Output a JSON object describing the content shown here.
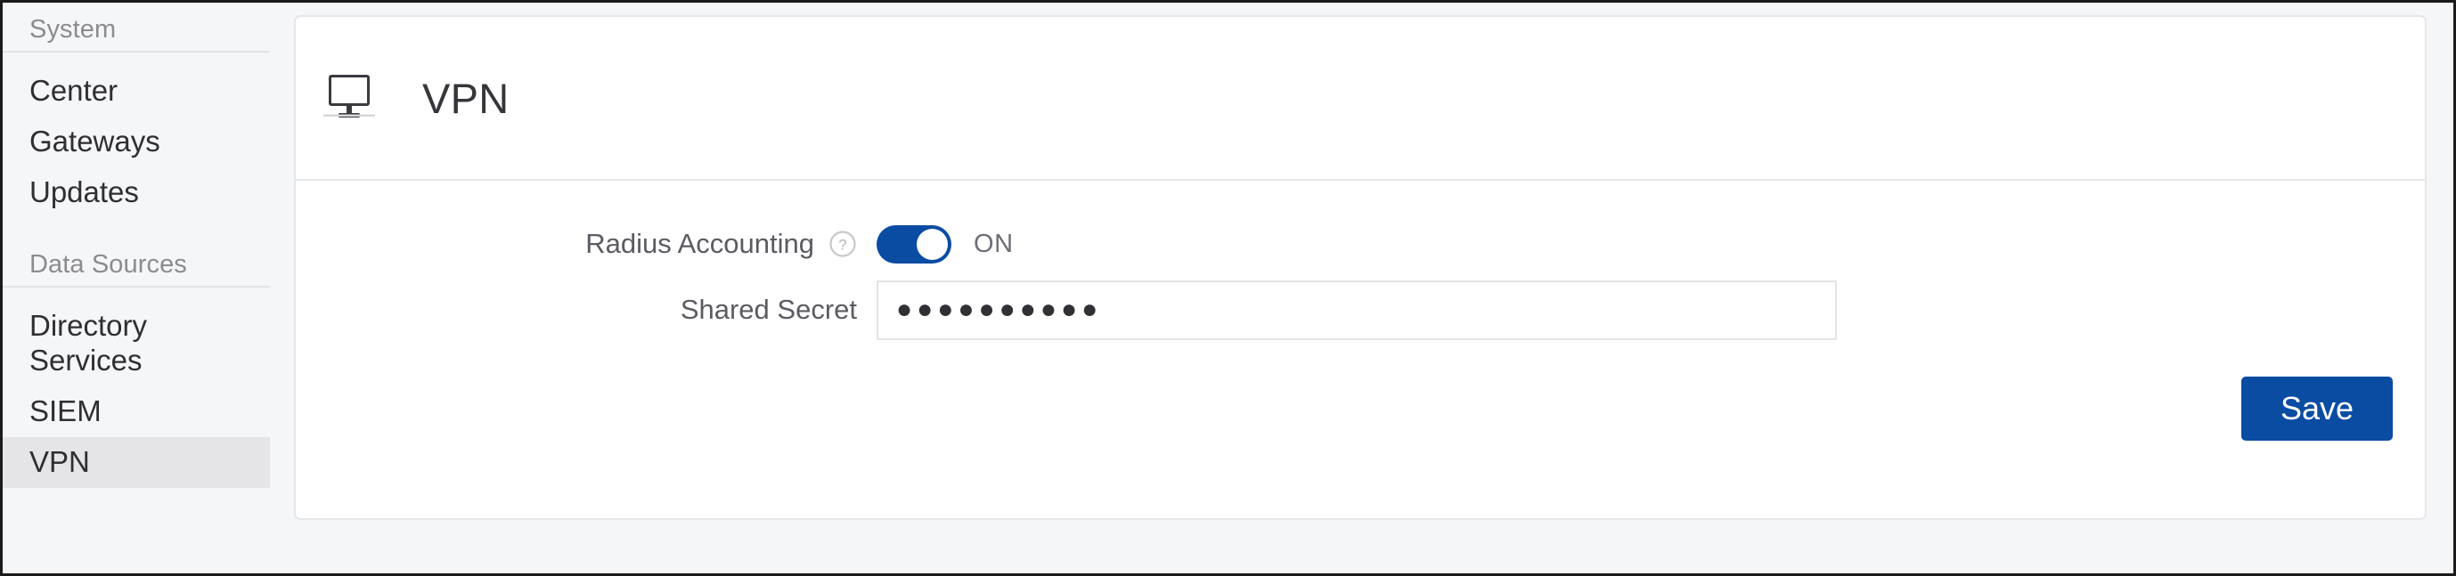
{
  "sidebar": {
    "sections": [
      {
        "title": "System",
        "items": [
          {
            "label": "Center",
            "selected": false
          },
          {
            "label": "Gateways",
            "selected": false
          },
          {
            "label": "Updates",
            "selected": false
          }
        ]
      },
      {
        "title": "Data Sources",
        "items": [
          {
            "label": "Directory\nServices",
            "selected": false
          },
          {
            "label": "SIEM",
            "selected": false
          },
          {
            "label": "VPN",
            "selected": true
          }
        ]
      }
    ]
  },
  "card": {
    "header": {
      "icon": "monitor-icon",
      "title": "VPN"
    },
    "fields": {
      "radius_accounting": {
        "label": "Radius Accounting",
        "help_icon": "help-circle-icon",
        "toggle_on": true,
        "state_label": "ON"
      },
      "shared_secret": {
        "label": "Shared Secret",
        "value": "●●●●●●●●●●",
        "placeholder": ""
      }
    },
    "save_label": "Save"
  },
  "colors": {
    "accent_blue": "#0b4ca3",
    "page_background": "#f5f6f8",
    "card_background": "#ffffff",
    "selected_nav_background": "#e5e5e8",
    "border": "#e6e7ea"
  }
}
